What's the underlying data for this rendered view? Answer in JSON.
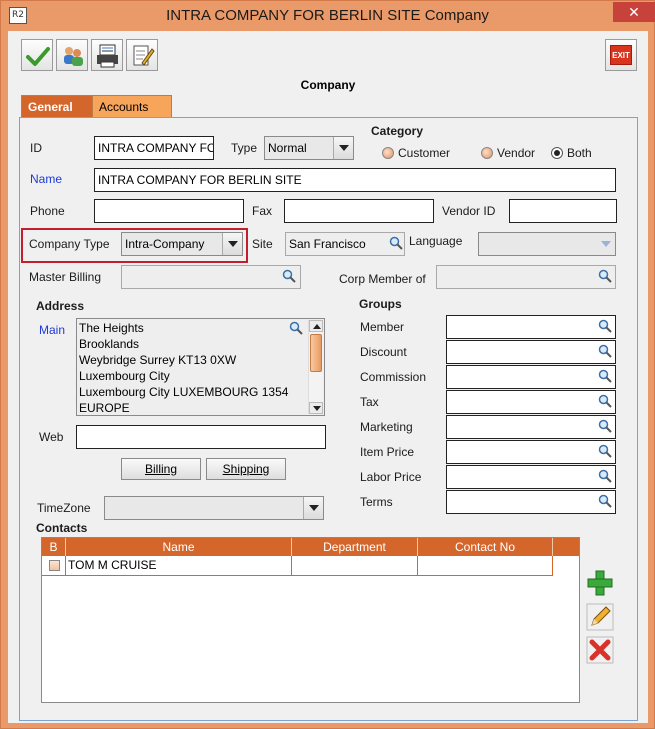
{
  "window": {
    "title": "INTRA COMPANY FOR BERLIN SITE Company",
    "app_icon": "R2",
    "close": "✕"
  },
  "toolbar": {
    "exit_label": "EXIT"
  },
  "form": {
    "heading": "Company",
    "tabs": [
      {
        "label": "General"
      },
      {
        "label": "Accounts"
      }
    ],
    "id_label": "ID",
    "id_value": "INTRA COMPANY FOR BERLIN SITE",
    "type_label": "Type",
    "type_value": "Normal",
    "category_label": "Category",
    "category_options": [
      "Customer",
      "Vendor",
      "Both"
    ],
    "category_selected": "Both",
    "name_label": "Name",
    "name_value": "INTRA COMPANY FOR BERLIN SITE",
    "phone_label": "Phone",
    "phone_value": "",
    "fax_label": "Fax",
    "fax_value": "",
    "vendor_id_label": "Vendor ID",
    "vendor_id_value": "",
    "company_type_label": "Company Type",
    "company_type_value": "Intra-Company",
    "site_label": "Site",
    "site_value": "San Francisco",
    "language_label": "Language",
    "language_value": "",
    "master_billing_label": "Master Billing",
    "corp_member_label": "Corp Member of",
    "address_label": "Address",
    "main_label": "Main",
    "address_lines": [
      "The Heights",
      "Brooklands",
      "Weybridge Surrey KT13 0XW",
      "Luxembourg City",
      "Luxembourg City LUXEMBOURG 1354",
      "EUROPE"
    ],
    "web_label": "Web",
    "web_value": "",
    "billing_button": "Billing",
    "shipping_button": "Shipping",
    "timezone_label": "TimeZone",
    "timezone_value": "",
    "groups_label": "Groups",
    "groups": [
      "Member",
      "Discount",
      "Commission",
      "Tax",
      "Marketing",
      "Item Price",
      "Labor Price",
      "Terms"
    ],
    "contacts_label": "Contacts",
    "contacts_columns": [
      "B",
      "Name",
      "Department",
      "Contact No"
    ],
    "contacts_rows": [
      {
        "name": "TOM M CRUISE",
        "department": "",
        "contact_no": ""
      }
    ]
  },
  "colors": {
    "frame": "#ea9a68",
    "tab_active": "#d4662c",
    "tab_inactive": "#f6a55a",
    "label_blue": "#1d3bd8",
    "highlight": "#c41e2c"
  }
}
